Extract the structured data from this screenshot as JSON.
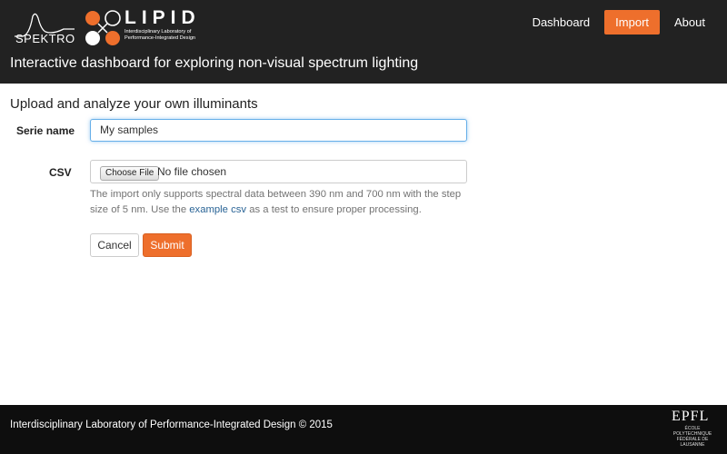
{
  "header": {
    "logo_spektro": "SPEKTRO",
    "logo_lipid": "LIPID",
    "logo_lipid_sub": "Interdisciplinary Laboratory of Performance-Integrated Design",
    "nav": [
      {
        "label": "Dashboard",
        "active": false
      },
      {
        "label": "Import",
        "active": true
      },
      {
        "label": "About",
        "active": false
      }
    ],
    "subtitle": "Interactive dashboard for exploring non-visual spectrum lighting"
  },
  "main": {
    "title": "Upload and analyze your own illuminants",
    "serie_label": "Serie name",
    "serie_value": "My samples",
    "csv_label": "CSV",
    "choose_file": "Choose File",
    "no_file": "No file chosen",
    "help_before": "The import only supports spectral data between 390 nm and 700 nm with the step size of 5 nm. Use the ",
    "help_link": "example csv",
    "help_after": " as a test to ensure proper processing.",
    "cancel": "Cancel",
    "submit": "Submit"
  },
  "footer": {
    "text": "Interdisciplinary Laboratory of Performance-Integrated Design © 2015",
    "epfl_logo": "EPFL",
    "epfl_sub": "ÉCOLE POLYTECHNIQUE FÉDÉRALE DE LAUSANNE"
  },
  "colors": {
    "header_bg": "#222222",
    "accent": "#ee6f2c",
    "footer_bg": "#0e0e0e",
    "link": "#2a6496"
  }
}
